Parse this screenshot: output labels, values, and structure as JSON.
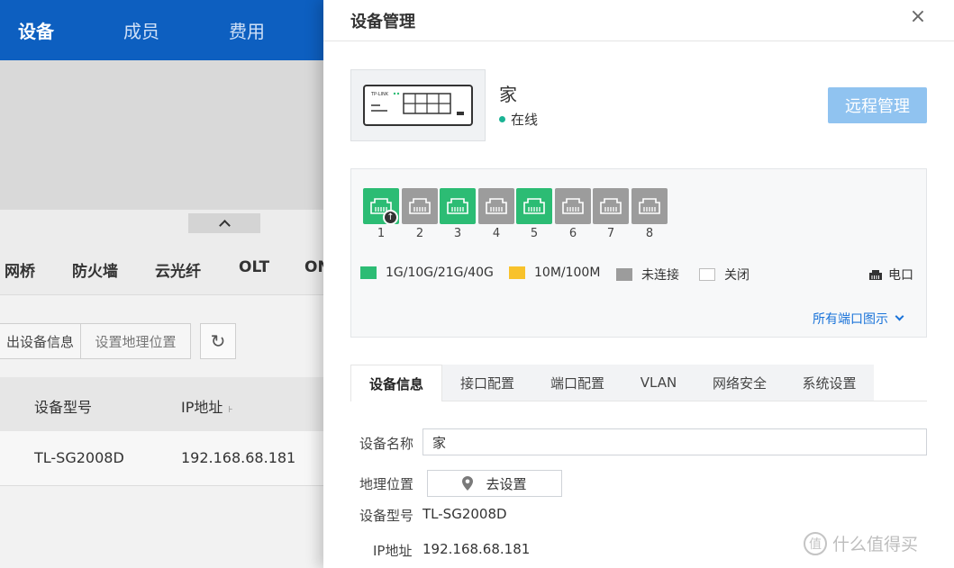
{
  "topnav": {
    "devices": "设备",
    "members": "成员",
    "fees": "费用"
  },
  "collapse_icon": "chevron-up-icon",
  "collapse_glyph": "^",
  "device_types": [
    "网桥",
    "防火墙",
    "云光纤",
    "OLT",
    "ON"
  ],
  "toolbar": {
    "export": "出设备信息",
    "set_location": "设置地理位置",
    "refresh_icon": "refresh-icon",
    "refresh_glyph": "↻"
  },
  "table": {
    "columns": [
      "设备型号",
      "IP地址"
    ],
    "sort_glyph": "⊦",
    "rows": [
      {
        "model": "TL-SG2008D",
        "ip": "192.168.68.181"
      }
    ]
  },
  "drawer": {
    "title": "设备管理",
    "close_glyph": "×",
    "device": {
      "name": "家",
      "status": "在线",
      "status_color": "#1ab394",
      "thumb_brand": "TP-LINK"
    },
    "remote_button": "远程管理",
    "ports": [
      {
        "num": "1",
        "state": "green",
        "uplink": true
      },
      {
        "num": "2",
        "state": "grey",
        "uplink": false
      },
      {
        "num": "3",
        "state": "green",
        "uplink": false
      },
      {
        "num": "4",
        "state": "grey",
        "uplink": false
      },
      {
        "num": "5",
        "state": "green",
        "uplink": false
      },
      {
        "num": "6",
        "state": "grey",
        "uplink": false
      },
      {
        "num": "7",
        "state": "grey",
        "uplink": false
      },
      {
        "num": "8",
        "state": "grey",
        "uplink": false
      }
    ],
    "legend": {
      "gigabit": "1G/10G/21G/40G",
      "fast": "10M/100M",
      "disconnected": "未连接",
      "closed": "关闭",
      "electric": "电口"
    },
    "colors": {
      "green": "#2cbc74",
      "yellow": "#f8c22b",
      "grey": "#9c9c9c",
      "link": "#1a73d9"
    },
    "all_ports_link": "所有端口图示",
    "tabs": [
      "设备信息",
      "接口配置",
      "端口配置",
      "VLAN",
      "网络安全",
      "系统设置"
    ],
    "info": {
      "name_label": "设备名称",
      "name_value": "家",
      "location_label": "地理位置",
      "location_button": "去设置",
      "model_label": "设备型号",
      "model_value": "TL-SG2008D",
      "ip_label": "IP地址",
      "ip_value": "192.168.68.181"
    }
  },
  "watermark": {
    "glyph": "值",
    "text": "什么值得买"
  }
}
